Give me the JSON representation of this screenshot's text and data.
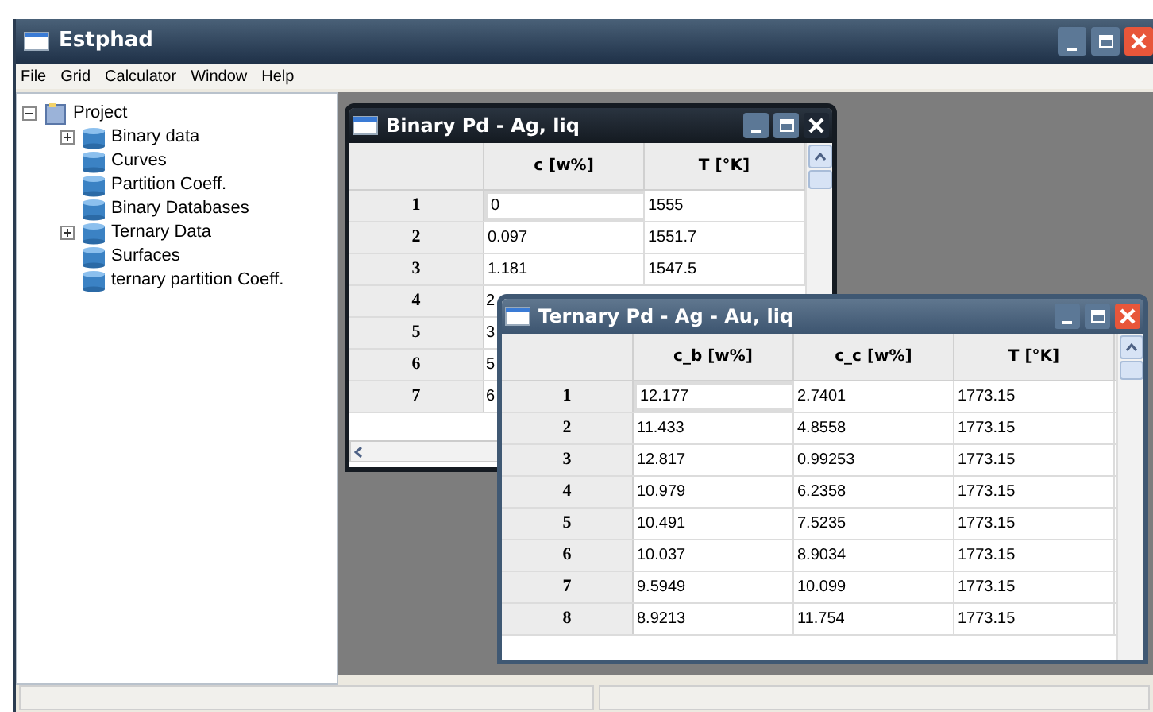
{
  "window": {
    "title": "Estphad"
  },
  "menu": [
    "File",
    "Grid",
    "Calculator",
    "Window",
    "Help"
  ],
  "tree": [
    {
      "label": "Project",
      "expanded": true,
      "children": [
        {
          "label": "Binary data",
          "expanded": false
        },
        {
          "label": "Curves"
        },
        {
          "label": "Partition Coeff."
        },
        {
          "label": "Binary Databases"
        },
        {
          "label": "Ternary Data",
          "expanded": false
        },
        {
          "label": "Surfaces"
        },
        {
          "label": "ternary partition Coeff."
        }
      ]
    }
  ],
  "child_windows": [
    {
      "title": "Binary Pd - Ag, liq",
      "active": false,
      "columns": [
        "c [w%]",
        "T [°K]"
      ],
      "rows": [
        {
          "header": "1",
          "cells": [
            "0",
            "1555"
          ]
        },
        {
          "header": "2",
          "cells": [
            "0.097",
            "1551.7"
          ]
        },
        {
          "header": "3",
          "cells": [
            "1.181",
            "1547.5"
          ]
        },
        {
          "header": "4",
          "cells": [
            "2",
            ""
          ]
        },
        {
          "header": "5",
          "cells": [
            "3",
            ""
          ]
        },
        {
          "header": "6",
          "cells": [
            "5",
            ""
          ]
        },
        {
          "header": "7",
          "cells": [
            "6",
            ""
          ]
        }
      ]
    },
    {
      "title": "Ternary Pd - Ag - Au, liq",
      "active": true,
      "columns": [
        "c_b [w%]",
        "c_c [w%]",
        "T [°K]"
      ],
      "rows": [
        {
          "header": "1",
          "cells": [
            "12.177",
            "2.7401",
            "1773.15"
          ]
        },
        {
          "header": "2",
          "cells": [
            "11.433",
            "4.8558",
            "1773.15"
          ]
        },
        {
          "header": "3",
          "cells": [
            "12.817",
            "0.99253",
            "1773.15"
          ]
        },
        {
          "header": "4",
          "cells": [
            "10.979",
            "6.2358",
            "1773.15"
          ]
        },
        {
          "header": "5",
          "cells": [
            "10.491",
            "7.5235",
            "1773.15"
          ]
        },
        {
          "header": "6",
          "cells": [
            "10.037",
            "8.9034",
            "1773.15"
          ]
        },
        {
          "header": "7",
          "cells": [
            "9.5949",
            "10.099",
            "1773.15"
          ]
        },
        {
          "header": "8",
          "cells": [
            "8.9213",
            "11.754",
            "1773.15"
          ]
        }
      ]
    }
  ]
}
